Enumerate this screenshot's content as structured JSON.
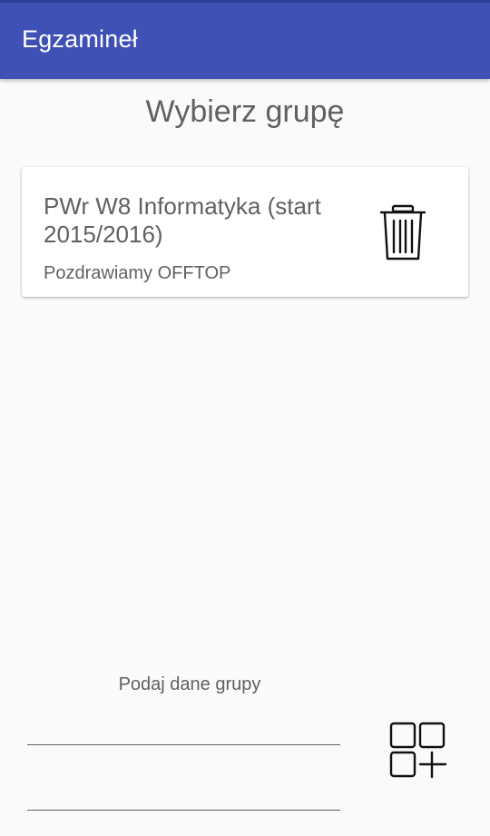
{
  "app_bar": {
    "title": "Egzamineł",
    "color": "#3f51b5"
  },
  "page": {
    "title": "Wybierz grupę"
  },
  "groups": [
    {
      "name": "PWr W8 Informatyka (start 2015/2016)",
      "description": "Pozdrawiamy OFFTOP",
      "delete_icon": "trash-can-icon"
    }
  ],
  "form": {
    "label": "Podaj dane grupy",
    "field_1_value": "",
    "field_2_value": "",
    "add_icon": "add-grid-icon"
  }
}
